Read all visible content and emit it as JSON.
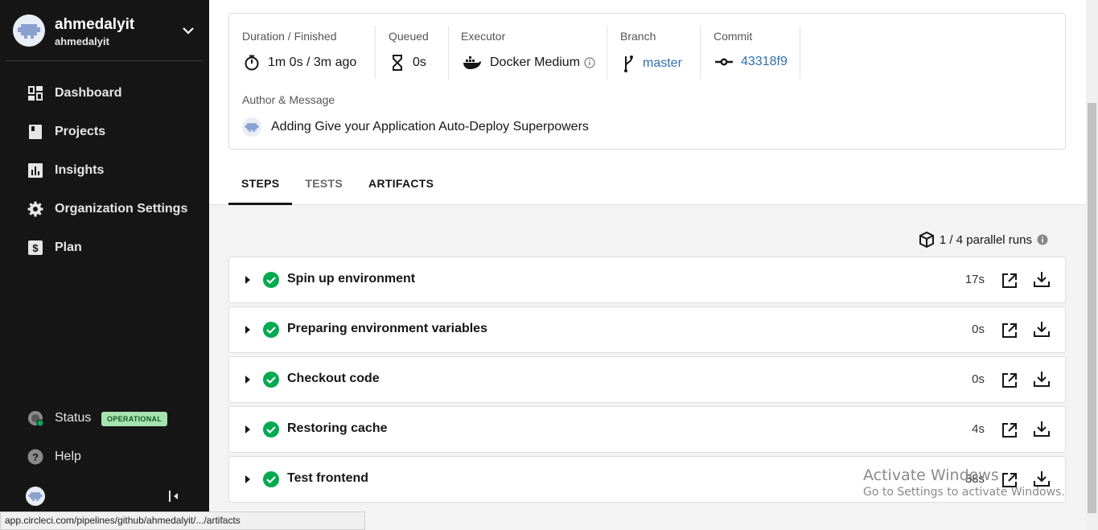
{
  "sidebar": {
    "org_name": "ahmedalyit",
    "org_sub": "ahmedalyit",
    "nav": [
      {
        "label": "Dashboard",
        "icon": "dashboard-icon"
      },
      {
        "label": "Projects",
        "icon": "projects-icon"
      },
      {
        "label": "Insights",
        "icon": "insights-icon"
      },
      {
        "label": "Organization Settings",
        "icon": "gear-icon"
      },
      {
        "label": "Plan",
        "icon": "dollar-icon"
      }
    ],
    "status_label": "Status",
    "status_badge": "OPERATIONAL",
    "help_label": "Help"
  },
  "job": {
    "duration_label": "Duration / Finished",
    "duration_value": "1m 0s / 3m ago",
    "queued_label": "Queued",
    "queued_value": "0s",
    "executor_label": "Executor",
    "executor_value": "Docker Medium",
    "branch_label": "Branch",
    "branch_value": "master",
    "commit_label": "Commit",
    "commit_value": "43318f9",
    "author_label": "Author & Message",
    "message": "Adding Give your Application Auto-Deploy Superpowers"
  },
  "tabs": [
    {
      "label": "STEPS",
      "active": true
    },
    {
      "label": "TESTS",
      "active": false
    },
    {
      "label": "ARTIFACTS",
      "active": false
    }
  ],
  "parallel_runs": "1 / 4 parallel runs",
  "steps": [
    {
      "name": "Spin up environment",
      "duration": "17s",
      "status": "success"
    },
    {
      "name": "Preparing environment variables",
      "duration": "0s",
      "status": "success"
    },
    {
      "name": "Checkout code",
      "duration": "0s",
      "status": "success"
    },
    {
      "name": "Restoring cache",
      "duration": "4s",
      "status": "success"
    },
    {
      "name": "Test frontend",
      "duration": "38s",
      "status": "success"
    }
  ],
  "colors": {
    "sidebar_bg": "#161616",
    "success": "#04aa51",
    "link": "#2f6fad",
    "badge_bg": "#a7e3b0"
  },
  "watermark": {
    "line1": "Activate Windows",
    "line2": "Go to Settings to activate Windows."
  },
  "statusbar_url": "app.circleci.com/pipelines/github/ahmedalyit/.../artifacts"
}
